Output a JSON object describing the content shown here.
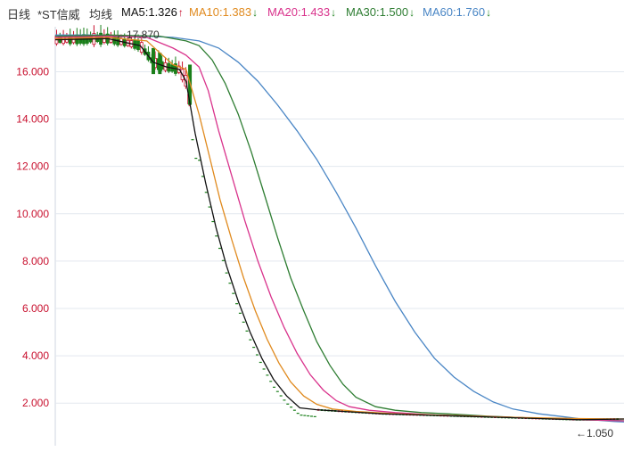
{
  "legend": {
    "period": "日线",
    "name": "*ST信威",
    "avg_label": "均线",
    "ma5": {
      "label": "MA5:1.326",
      "arrow": "↑",
      "arrow_color": "#c8102e",
      "color": "#111111"
    },
    "ma10": {
      "label": "MA10:1.383",
      "arrow": "↓",
      "arrow_color": "#1a7f1a",
      "color": "#e08a1e"
    },
    "ma20": {
      "label": "MA20:1.433",
      "arrow": "↓",
      "arrow_color": "#1a7f1a",
      "color": "#d9338c"
    },
    "ma30": {
      "label": "MA30:1.500",
      "arrow": "↓",
      "arrow_color": "#1a7f1a",
      "color": "#2e7d32"
    },
    "ma60": {
      "label": "MA60:1.760",
      "arrow": "↓",
      "arrow_color": "#1a7f1a",
      "color": "#4a86c5"
    }
  },
  "chart_data": {
    "type": "line",
    "ylim": [
      0.2,
      17.9
    ],
    "yticks": [
      "2.000",
      "4.000",
      "6.000",
      "8.000",
      "10.000",
      "12.000",
      "14.000",
      "16.000"
    ],
    "annotations": {
      "high": "←17.870",
      "low": "←1.050"
    },
    "series": [
      {
        "key": "ma60",
        "color": "#4a86c5",
        "points": [
          [
            0,
            17.55
          ],
          [
            30,
            17.55
          ],
          [
            70,
            17.5
          ],
          [
            90,
            17.45
          ],
          [
            110,
            17.3
          ],
          [
            125,
            17.0
          ],
          [
            140,
            16.4
          ],
          [
            155,
            15.6
          ],
          [
            170,
            14.6
          ],
          [
            185,
            13.5
          ],
          [
            200,
            12.3
          ],
          [
            215,
            10.9
          ],
          [
            230,
            9.4
          ],
          [
            245,
            7.8
          ],
          [
            260,
            6.3
          ],
          [
            275,
            5.0
          ],
          [
            290,
            3.9
          ],
          [
            305,
            3.1
          ],
          [
            320,
            2.5
          ],
          [
            335,
            2.05
          ],
          [
            350,
            1.75
          ],
          [
            370,
            1.55
          ],
          [
            385,
            1.45
          ],
          [
            400,
            1.35
          ],
          [
            415,
            1.28
          ],
          [
            428,
            1.22
          ],
          [
            435,
            1.2
          ]
        ]
      },
      {
        "key": "ma30",
        "color": "#2e7d32",
        "points": [
          [
            0,
            17.5
          ],
          [
            40,
            17.55
          ],
          [
            80,
            17.5
          ],
          [
            100,
            17.3
          ],
          [
            110,
            17.1
          ],
          [
            120,
            16.5
          ],
          [
            130,
            15.5
          ],
          [
            140,
            14.2
          ],
          [
            150,
            12.6
          ],
          [
            160,
            10.8
          ],
          [
            170,
            9.0
          ],
          [
            180,
            7.3
          ],
          [
            190,
            5.9
          ],
          [
            200,
            4.6
          ],
          [
            210,
            3.6
          ],
          [
            220,
            2.8
          ],
          [
            230,
            2.25
          ],
          [
            245,
            1.85
          ],
          [
            260,
            1.7
          ],
          [
            280,
            1.6
          ],
          [
            300,
            1.55
          ],
          [
            330,
            1.45
          ],
          [
            360,
            1.38
          ],
          [
            400,
            1.3
          ],
          [
            435,
            1.26
          ]
        ]
      },
      {
        "key": "ma20",
        "color": "#d9338c",
        "points": [
          [
            0,
            17.45
          ],
          [
            40,
            17.5
          ],
          [
            70,
            17.45
          ],
          [
            90,
            17.0
          ],
          [
            100,
            16.7
          ],
          [
            110,
            16.2
          ],
          [
            117,
            15.2
          ],
          [
            125,
            13.5
          ],
          [
            135,
            11.6
          ],
          [
            145,
            9.7
          ],
          [
            155,
            8.0
          ],
          [
            165,
            6.5
          ],
          [
            175,
            5.2
          ],
          [
            185,
            4.1
          ],
          [
            195,
            3.2
          ],
          [
            205,
            2.55
          ],
          [
            215,
            2.1
          ],
          [
            225,
            1.85
          ],
          [
            240,
            1.7
          ],
          [
            260,
            1.6
          ],
          [
            290,
            1.5
          ],
          [
            320,
            1.45
          ],
          [
            350,
            1.4
          ],
          [
            390,
            1.32
          ],
          [
            435,
            1.25
          ]
        ]
      },
      {
        "key": "ma10",
        "color": "#e08a1e",
        "points": [
          [
            0,
            17.4
          ],
          [
            40,
            17.45
          ],
          [
            70,
            17.3
          ],
          [
            80,
            16.8
          ],
          [
            90,
            16.3
          ],
          [
            100,
            16.1
          ],
          [
            110,
            14.2
          ],
          [
            118,
            12.4
          ],
          [
            126,
            10.6
          ],
          [
            135,
            8.9
          ],
          [
            144,
            7.3
          ],
          [
            153,
            5.9
          ],
          [
            162,
            4.7
          ],
          [
            171,
            3.7
          ],
          [
            180,
            2.9
          ],
          [
            190,
            2.3
          ],
          [
            200,
            1.95
          ],
          [
            212,
            1.75
          ],
          [
            230,
            1.65
          ],
          [
            260,
            1.55
          ],
          [
            290,
            1.5
          ],
          [
            320,
            1.45
          ],
          [
            350,
            1.4
          ],
          [
            400,
            1.35
          ],
          [
            435,
            1.33
          ]
        ]
      },
      {
        "key": "ma5",
        "color": "#111111",
        "points": [
          [
            0,
            17.35
          ],
          [
            40,
            17.4
          ],
          [
            65,
            17.1
          ],
          [
            75,
            16.4
          ],
          [
            85,
            16.2
          ],
          [
            95,
            16.1
          ],
          [
            100,
            15.6
          ],
          [
            107,
            13.4
          ],
          [
            115,
            11.3
          ],
          [
            123,
            9.4
          ],
          [
            131,
            7.8
          ],
          [
            140,
            6.3
          ],
          [
            149,
            5.0
          ],
          [
            158,
            3.9
          ],
          [
            167,
            3.0
          ],
          [
            177,
            2.3
          ],
          [
            187,
            1.8
          ],
          [
            200,
            1.72
          ],
          [
            220,
            1.65
          ],
          [
            250,
            1.55
          ],
          [
            280,
            1.5
          ],
          [
            310,
            1.45
          ],
          [
            340,
            1.4
          ],
          [
            370,
            1.35
          ],
          [
            400,
            1.3
          ],
          [
            435,
            1.33
          ]
        ]
      }
    ]
  }
}
